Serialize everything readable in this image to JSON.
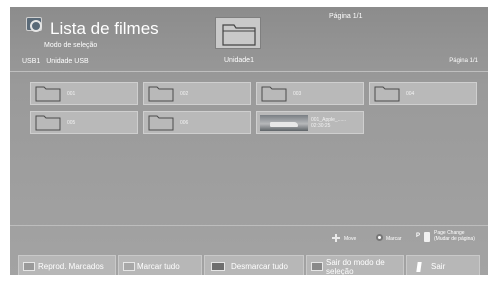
{
  "header": {
    "title": "Lista de filmes",
    "mode": "Modo de seleção",
    "breadcrumb": [
      "USB1",
      "Unidade USB"
    ],
    "current_folder": "Unidade1",
    "page_top": "Página 1/1",
    "page_right": "Página 1/1",
    "app_icon": "film-reel-icon",
    "folder_icon": "folder-icon"
  },
  "items": [
    {
      "type": "folder",
      "label": "001"
    },
    {
      "type": "folder",
      "label": "002"
    },
    {
      "type": "folder",
      "label": "003"
    },
    {
      "type": "folder",
      "label": "004"
    },
    {
      "type": "folder",
      "label": "005"
    },
    {
      "type": "folder",
      "label": "006"
    },
    {
      "type": "video",
      "label": "001_Apple_......",
      "duration": "02:30:25"
    }
  ],
  "hints": {
    "move": "Move",
    "mark": "Marcar",
    "page_key": "P",
    "page_change": "Page Change",
    "page_change_sub": "(Mudar de página)"
  },
  "buttons": {
    "play_marked": "Reprod. Marcados",
    "mark_all": "Marcar tudo",
    "unmark_all": "Desmarcar tudo",
    "exit_mode": "Sair do modo de seleção",
    "exit": "Sair"
  }
}
